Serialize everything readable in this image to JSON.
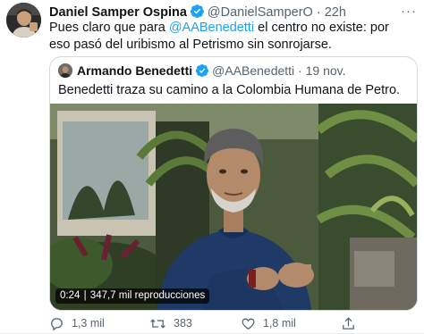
{
  "tweet": {
    "author_name": "Daniel Samper Ospina",
    "author_handle": "@DanielSamperO",
    "separator": "·",
    "time": "22h",
    "text_before": "Pues claro que para ",
    "mention": "@AABenedetti",
    "text_after": " el centro no existe: por eso pasó del uribismo al Petrismo sin sonrojarse."
  },
  "quoted": {
    "author_name": "Armando Benedetti",
    "author_handle": "@AABenedetti",
    "separator": "·",
    "date": "19 nov.",
    "text": "Benedetti traza su camino a la Colombia Humana de Petro.",
    "video": {
      "duration": "0:24",
      "separator": "|",
      "views": "347,7 mil reproducciones"
    }
  },
  "actions": {
    "reply_count": "1,3 mil",
    "retweet_count": "383",
    "like_count": "1,8 mil"
  },
  "colors": {
    "link": "#1da1f2",
    "muted": "#536471",
    "border": "#cfd9de"
  },
  "icons": [
    "verified-icon",
    "more-icon",
    "reply-icon",
    "retweet-icon",
    "like-icon",
    "share-icon"
  ]
}
